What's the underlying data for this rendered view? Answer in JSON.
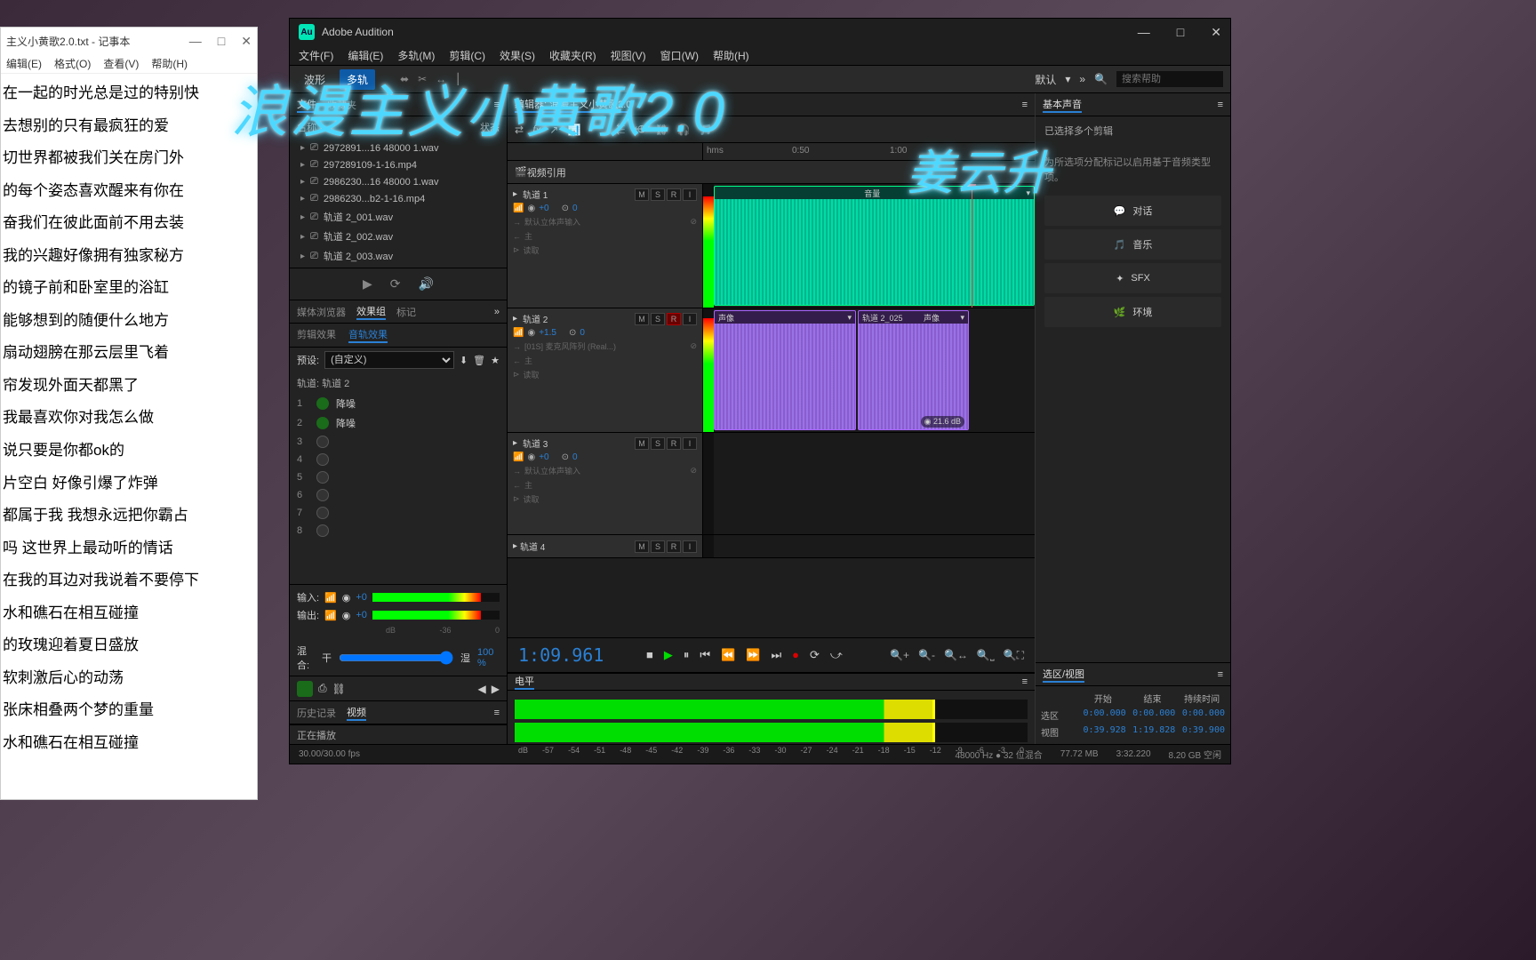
{
  "overlay": {
    "title": "浪漫主义小黄歌2.0",
    "subtitle": "姜云升"
  },
  "notepad": {
    "title": "主义小黄歌2.0.txt - 记事本",
    "menus": [
      "编辑(E)",
      "格式(O)",
      "查看(V)",
      "帮助(H)"
    ],
    "lines": [
      "在一起的时光总是过的特别快",
      "去想别的只有最疯狂的爱",
      "切世界都被我们关在房门外",
      "的每个姿态喜欢醒来有你在",
      "奋我们在彼此面前不用去装",
      "我的兴趣好像拥有独家秘方",
      "的镜子前和卧室里的浴缸",
      "能够想到的随便什么地方",
      "扇动翅膀在那云层里飞着",
      "帘发现外面天都黑了",
      "我最喜欢你对我怎么做",
      "说只要是你都ok的",
      "片空白 好像引爆了炸弹",
      "都属于我 我想永远把你霸占",
      "吗 这世界上最动听的情话",
      "在我的耳边对我说着不要停下",
      "水和礁石在相互碰撞",
      "的玫瑰迎着夏日盛放",
      "软刺激后心的动荡",
      "张床相叠两个梦的重量",
      "水和礁石在相互碰撞"
    ]
  },
  "audition": {
    "app": "Adobe Audition",
    "menus": [
      "文件(F)",
      "编辑(E)",
      "多轨(M)",
      "剪辑(C)",
      "效果(S)",
      "收藏夹(R)",
      "视图(V)",
      "窗口(W)",
      "帮助(H)"
    ],
    "toolbar": {
      "waveform": "波形",
      "multitrack": "多轨"
    },
    "workspace": "默认",
    "search_ph": "搜索帮助",
    "files": {
      "tabs": [
        "文件",
        "收藏夹"
      ],
      "cols": {
        "name": "名称 ↑",
        "status": "状态"
      },
      "items": [
        "2972891...16 48000 1.wav",
        "297289109-1-16.mp4",
        "2986230...16 48000 1.wav",
        "2986230...b2-1-16.mp4",
        "轨道 2_001.wav",
        "轨道 2_002.wav",
        "轨道 2_003.wav"
      ]
    },
    "effects": {
      "tabs": [
        "媒体浏览器",
        "效果组",
        "标记"
      ],
      "subtabs": [
        "剪辑效果",
        "音轨效果"
      ],
      "preset_label": "预设:",
      "preset_value": "(自定义)",
      "track": "轨道: 轨道 2",
      "slots": [
        {
          "n": "1",
          "on": true,
          "name": "降噪"
        },
        {
          "n": "2",
          "on": true,
          "name": "降噪"
        },
        {
          "n": "3",
          "on": false,
          "name": ""
        },
        {
          "n": "4",
          "on": false,
          "name": ""
        },
        {
          "n": "5",
          "on": false,
          "name": ""
        },
        {
          "n": "6",
          "on": false,
          "name": ""
        },
        {
          "n": "7",
          "on": false,
          "name": ""
        },
        {
          "n": "8",
          "on": false,
          "name": ""
        }
      ],
      "input": "输入:",
      "output": "输出:",
      "io_val": "+0",
      "mix": "混合:",
      "dry": "干",
      "wet": "湿",
      "mix_val": "100 %",
      "db": "dB",
      "db_ticks": [
        "-36",
        "0"
      ]
    },
    "history": {
      "tabs": [
        "历史记录",
        "视频"
      ]
    },
    "editor": {
      "tab": "编辑器: 浪漫主义小黄歌2.0",
      "timeline": {
        "unit": "hms",
        "ticks": [
          "0:50",
          "1:00"
        ]
      },
      "video_ref": "视频引用",
      "tracks": [
        {
          "name": "轨道 1",
          "vol": "+0",
          "pan": "0",
          "io": "默认立体声输入",
          "main": "主",
          "read": "读取"
        },
        {
          "name": "轨道 2",
          "vol": "+1.5",
          "pan": "0",
          "io": "[01S] 麦克风阵列 (Real...)",
          "main": "主",
          "read": "读取",
          "rec": true
        },
        {
          "name": "轨道 3",
          "vol": "+0",
          "pan": "0",
          "io": "默认立体声输入",
          "main": "主",
          "read": "读取"
        },
        {
          "name": "轨道 4",
          "vol": "",
          "pan": "",
          "io": "",
          "main": "",
          "read": ""
        }
      ],
      "clips": {
        "t1_label": "音量",
        "t2_label1": "声像",
        "t2_clip": "轨道 2_025",
        "t2_label2": "声像",
        "t2_db": "21.6 dB"
      },
      "timecode": "1:09.961"
    },
    "levels": {
      "title": "电平",
      "scale": [
        "dB",
        "-57",
        "-54",
        "-51",
        "-48",
        "-45",
        "-42",
        "-39",
        "-36",
        "-33",
        "-30",
        "-27",
        "-24",
        "-21",
        "-18",
        "-15",
        "-12",
        "-9",
        "-6",
        "-3",
        "0"
      ]
    },
    "right": {
      "title": "基本声音",
      "preset": "已选择多个剪辑",
      "hint": "为所选项分配标记以启用基于音频类型项。",
      "cats": [
        "对话",
        "音乐",
        "SFX",
        "环境"
      ]
    },
    "selection": {
      "title": "选区/视图",
      "cols": [
        "开始",
        "结束",
        "持续时间"
      ],
      "rows": [
        {
          "l": "选区",
          "v": [
            "0:00.000",
            "0:00.000",
            "0:00.000"
          ]
        },
        {
          "l": "视图",
          "v": [
            "0:39.928",
            "1:19.828",
            "0:39.900"
          ]
        }
      ]
    },
    "status": {
      "playing": "正在播放",
      "fps": "30.00/30.00 fps",
      "rate": "48000 Hz ● 32 位混合",
      "mem": "77.72 MB",
      "dur": "3:32.220",
      "free": "8.20 GB 空闲"
    }
  }
}
